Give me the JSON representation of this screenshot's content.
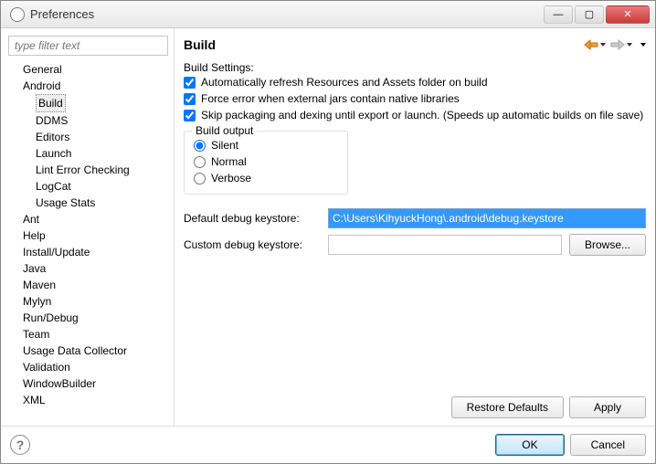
{
  "window": {
    "title": "Preferences"
  },
  "filter": {
    "placeholder": "type filter text"
  },
  "tree": {
    "items": [
      {
        "label": "General",
        "lvl": 1
      },
      {
        "label": "Android",
        "lvl": 1
      },
      {
        "label": "Build",
        "lvl": 2,
        "selected": true
      },
      {
        "label": "DDMS",
        "lvl": 2
      },
      {
        "label": "Editors",
        "lvl": 2
      },
      {
        "label": "Launch",
        "lvl": 2
      },
      {
        "label": "Lint Error Checking",
        "lvl": 2
      },
      {
        "label": "LogCat",
        "lvl": 2
      },
      {
        "label": "Usage Stats",
        "lvl": 2
      },
      {
        "label": "Ant",
        "lvl": 1
      },
      {
        "label": "Help",
        "lvl": 1
      },
      {
        "label": "Install/Update",
        "lvl": 1
      },
      {
        "label": "Java",
        "lvl": 1
      },
      {
        "label": "Maven",
        "lvl": 1
      },
      {
        "label": "Mylyn",
        "lvl": 1
      },
      {
        "label": "Run/Debug",
        "lvl": 1
      },
      {
        "label": "Team",
        "lvl": 1
      },
      {
        "label": "Usage Data Collector",
        "lvl": 1
      },
      {
        "label": "Validation",
        "lvl": 1
      },
      {
        "label": "WindowBuilder",
        "lvl": 1
      },
      {
        "label": "XML",
        "lvl": 1
      }
    ]
  },
  "page": {
    "title": "Build",
    "settingsHeading": "Build Settings:",
    "checks": {
      "autoRefresh": "Automatically refresh Resources and Assets folder on build",
      "forceError": "Force error when external jars contain native libraries",
      "skipPackaging": "Skip packaging and dexing until export or launch. (Speeds up automatic builds on file save)"
    },
    "buildOutput": {
      "legend": "Build output",
      "silent": "Silent",
      "normal": "Normal",
      "verbose": "Verbose"
    },
    "defaultKeystoreLabel": "Default debug keystore:",
    "defaultKeystoreValue": "C:\\Users\\KihyuckHong\\.android\\debug.keystore",
    "customKeystoreLabel": "Custom debug keystore:",
    "customKeystoreValue": "",
    "browse": "Browse...",
    "restoreDefaults": "Restore Defaults",
    "apply": "Apply"
  },
  "dialog": {
    "ok": "OK",
    "cancel": "Cancel"
  }
}
